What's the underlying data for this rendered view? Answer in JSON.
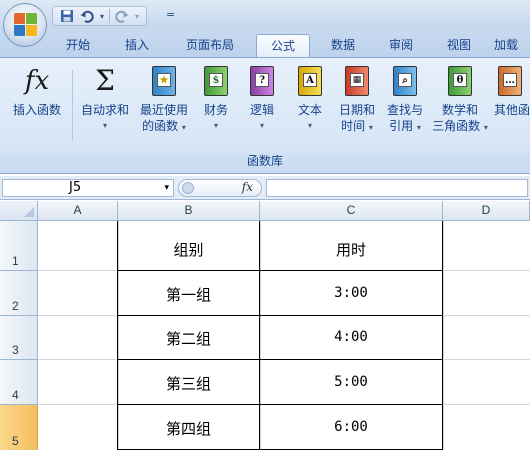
{
  "quick_access": {
    "save_icon": "save-icon",
    "undo_icon": "undo-icon",
    "redo_icon": "redo-icon",
    "customize_glyph": "="
  },
  "tabs": [
    {
      "label": "开始"
    },
    {
      "label": "插入"
    },
    {
      "label": "页面布局"
    },
    {
      "label": "公式",
      "active": true
    },
    {
      "label": "数据"
    },
    {
      "label": "审阅"
    },
    {
      "label": "视图"
    },
    {
      "label": "加载"
    }
  ],
  "ribbon": {
    "insert_function": "插入函数",
    "autosum": "自动求和",
    "recent_line1": "最近使用",
    "recent_line2": "的函数",
    "financial": "财务",
    "logical": "逻辑",
    "text": "文本",
    "date_line1": "日期和",
    "date_line2": "时间",
    "lookup_line1": "查找与",
    "lookup_line2": "引用",
    "math_line1": "数学和",
    "math_line2": "三角函数",
    "more_line1": "其他函",
    "group_label": "函数库",
    "glyph_fx": "fx",
    "glyph_sigma": "Σ",
    "glyph_recent": "★",
    "glyph_financial": "$",
    "glyph_logical": "?",
    "glyph_text": "A",
    "glyph_date": "▦",
    "glyph_lookup": "⌕",
    "glyph_math": "θ",
    "glyph_more": "…",
    "dropdown_caret": "▾"
  },
  "formula_bar": {
    "name_box": "J5",
    "name_box_dropdown": "▾",
    "fx_label": "fx",
    "formula": ""
  },
  "columns": [
    "A",
    "B",
    "C",
    "D"
  ],
  "rows": [
    "1",
    "2",
    "3",
    "4",
    "5"
  ],
  "cells": {
    "b1": "组别",
    "c1": "用时",
    "b2": "第一组",
    "c2": "3:00",
    "b3": "第二组",
    "c3": "4:00",
    "b4": "第三组",
    "c4": "5:00",
    "b5": "第四组",
    "c5": "6:00"
  },
  "colors": {
    "ribbon_text": "#15428b",
    "selected_row_header": "#f5be5f"
  }
}
